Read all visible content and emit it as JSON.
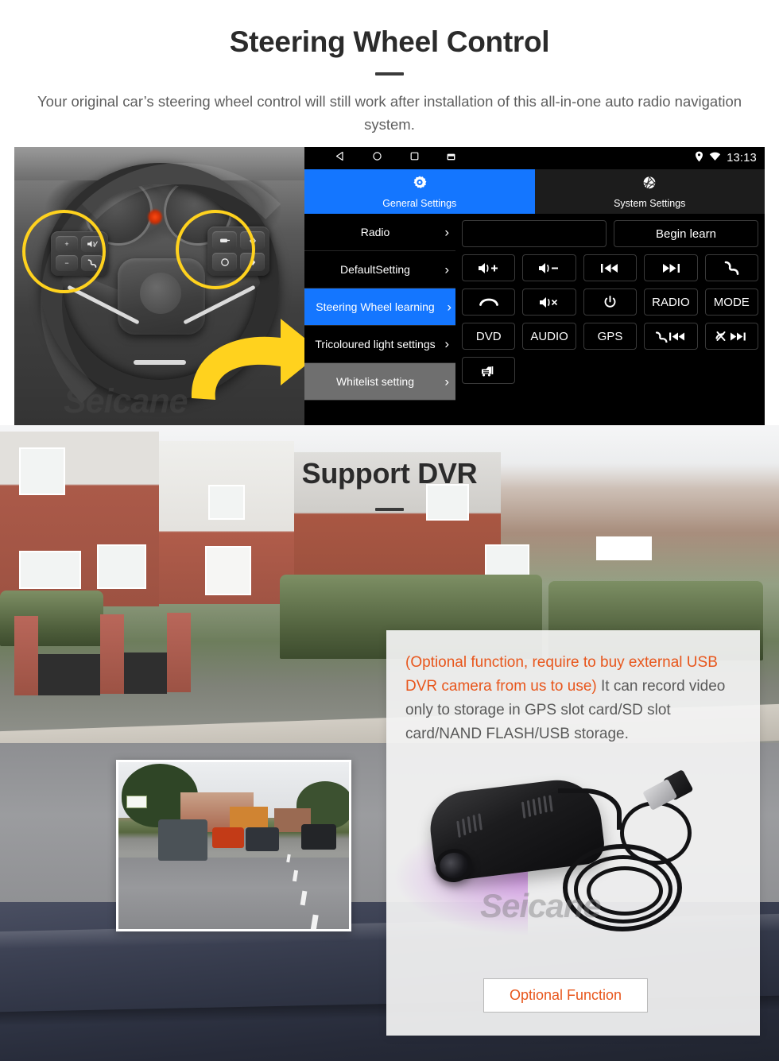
{
  "section1": {
    "title": "Steering Wheel Control",
    "subtitle": "Your original car’s steering wheel control will still work after installation of this all-in-one auto radio navigation system."
  },
  "head_unit": {
    "status_bar": {
      "nav_icons": [
        "back-icon",
        "home-icon",
        "recents-icon",
        "screenshot-icon"
      ],
      "system_icons": [
        "location-pin-icon",
        "wifi-icon"
      ],
      "time": "13:13"
    },
    "tabs": [
      {
        "label": "General Settings",
        "icon": "gear-icon",
        "active": true
      },
      {
        "label": "System Settings",
        "icon": "aperture-icon",
        "active": false
      }
    ],
    "menu_items": [
      {
        "label": "Radio",
        "state": "normal"
      },
      {
        "label": "DefaultSetting",
        "state": "normal"
      },
      {
        "label": "Steering Wheel learning",
        "state": "selected"
      },
      {
        "label": "Tricoloured light settings",
        "state": "normal"
      },
      {
        "label": "Whitelist setting",
        "state": "dimmed"
      }
    ],
    "learn_input": {
      "value": "",
      "placeholder": ""
    },
    "begin_learn_label": "Begin learn",
    "function_buttons": [
      {
        "label": "",
        "icon": "volume-up-icon"
      },
      {
        "label": "",
        "icon": "volume-down-icon"
      },
      {
        "label": "",
        "icon": "previous-track-icon"
      },
      {
        "label": "",
        "icon": "next-track-icon"
      },
      {
        "label": "",
        "icon": "call-answer-icon"
      },
      {
        "label": "",
        "icon": "call-hangup-icon"
      },
      {
        "label": "",
        "icon": "volume-mute-icon"
      },
      {
        "label": "",
        "icon": "power-icon"
      },
      {
        "label": "RADIO",
        "icon": ""
      },
      {
        "label": "MODE",
        "icon": ""
      },
      {
        "label": "DVD",
        "icon": ""
      },
      {
        "label": "AUDIO",
        "icon": ""
      },
      {
        "label": "GPS",
        "icon": ""
      },
      {
        "label": "",
        "icon": "call-previous-icon"
      },
      {
        "label": "",
        "icon": "callend-next-icon"
      },
      {
        "label": "",
        "icon": "car-screen-icon"
      }
    ]
  },
  "steering_photo": {
    "watermark": "Seicane",
    "left_pad_keys": [
      "+",
      "−",
      "mute-speaker-icon",
      "call-icon"
    ],
    "right_pad_keys": [
      "source-icon",
      "up-icon",
      "circle-icon",
      "down-icon"
    ]
  },
  "section2": {
    "title": "Support DVR",
    "note_orange": "(Optional function, require to buy external USB DVR camera from us to use)",
    "note_gray": "It can record video only to storage in GPS slot card/SD slot card/NAND FLASH/USB storage.",
    "optional_button_label": "Optional Function",
    "watermark": "Seicane"
  },
  "colors": {
    "accent_blue": "#1476ff",
    "accent_orange": "#e8561c",
    "highlight_yellow": "#ffd21e",
    "heading_dark": "#2b2b2b",
    "body_gray": "#5e5e5e"
  }
}
